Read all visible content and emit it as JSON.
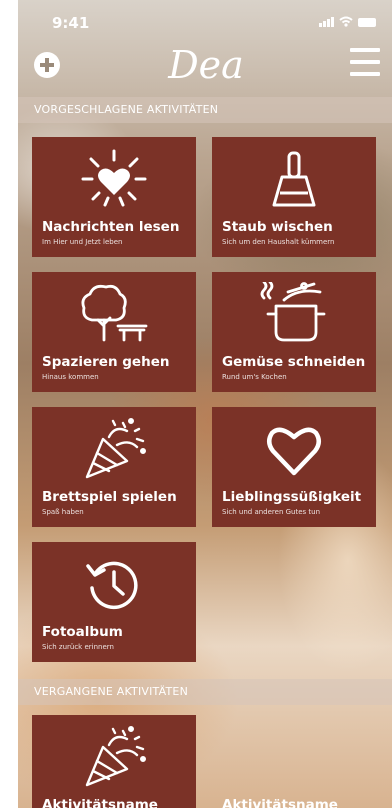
{
  "status": {
    "time": "9:41"
  },
  "header": {
    "logo": "Dea"
  },
  "sections": {
    "suggested": "VORGESCHLAGENE AKTIVITÄTEN",
    "past": "VERGANGENE AKTIVITÄTEN"
  },
  "suggested": [
    {
      "title": "Nachrichten lesen",
      "subtitle": "Im Hier und Jetzt leben",
      "icon": "sun-heart-icon"
    },
    {
      "title": "Staub wischen",
      "subtitle": "Sich um den Haushalt kümmern",
      "icon": "broom-icon"
    },
    {
      "title": "Spazieren gehen",
      "subtitle": "Hinaus kommen",
      "icon": "tree-bench-icon"
    },
    {
      "title": "Gemüse schneiden",
      "subtitle": "Rund um's Kochen",
      "icon": "cooking-pot-icon"
    },
    {
      "title": "Brettspiel spielen",
      "subtitle": "Spaß haben",
      "icon": "party-popper-icon"
    },
    {
      "title": "Lieblingssüßigkeit",
      "subtitle": "Sich und anderen Gutes tun",
      "icon": "heart-icon"
    },
    {
      "title": "Fotoalbum",
      "subtitle": "Sich zurück erinnern",
      "icon": "history-clock-icon"
    }
  ],
  "past": [
    {
      "title": "Aktivitätsname",
      "icon": "party-popper-icon"
    },
    {
      "title": "Aktivitätsname"
    }
  ],
  "colors": {
    "card": "#7b3227",
    "section_bar": "#d6c4ba"
  }
}
